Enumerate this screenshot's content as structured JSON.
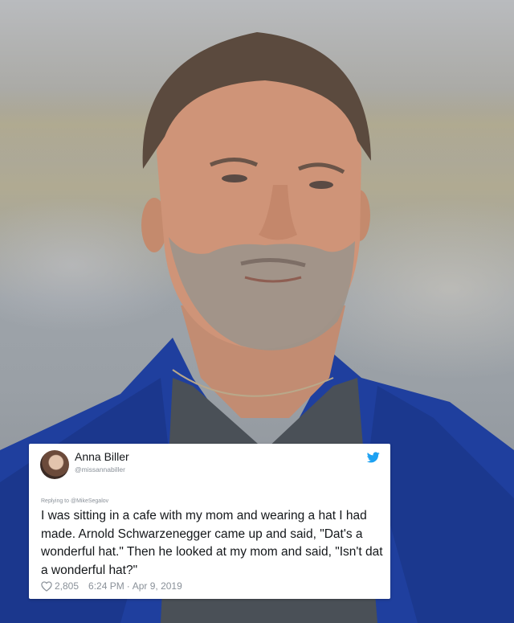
{
  "tweet": {
    "name": "Anna Biller",
    "handle": "@missannabiller",
    "replying_to": "Replying to @MikeSegalov",
    "text": "I was sitting in a cafe with my mom and wearing a hat I  had made. Arnold Schwarzenegger came up and said, \"Dat's a wonderful hat.\" Then he looked at my mom and said, \"Isn't dat a wonderful hat?\"",
    "likes": "2,805",
    "time": "6:24 PM",
    "separator": "·",
    "date": "Apr 9, 2019"
  },
  "colors": {
    "twitter_blue": "#1da1f2",
    "jacket_blue": "#1f3f9e",
    "shirt_gray": "#4a5057"
  },
  "icons": [
    "heart-icon",
    "twitter-bird-icon"
  ]
}
